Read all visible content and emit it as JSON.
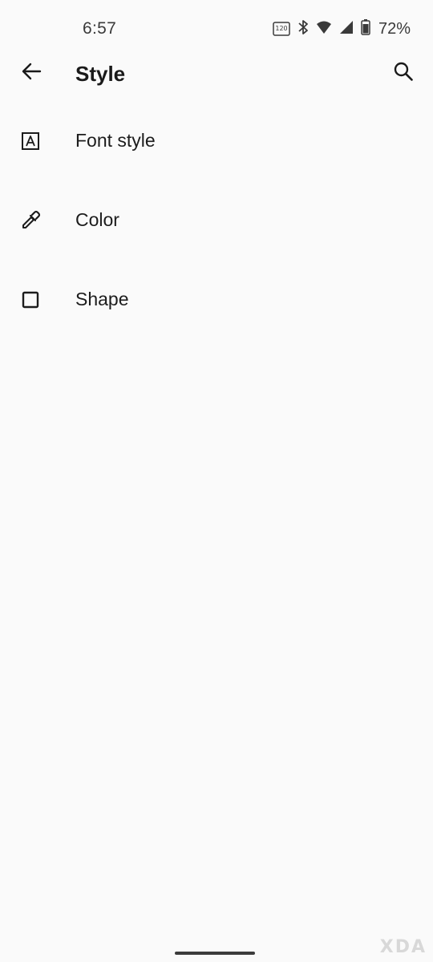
{
  "status_bar": {
    "time": "6:57",
    "refresh_rate_badge": "120",
    "battery_percent": "72%",
    "icons": [
      "refresh-rate-icon",
      "bluetooth-icon",
      "wifi-icon",
      "signal-icon",
      "battery-icon"
    ]
  },
  "app_bar": {
    "title": "Style",
    "back_icon": "arrow-back-icon",
    "search_icon": "search-icon"
  },
  "menu": {
    "items": [
      {
        "label": "Font style",
        "icon": "font-style-icon"
      },
      {
        "label": "Color",
        "icon": "eyedropper-icon"
      },
      {
        "label": "Shape",
        "icon": "square-outline-icon"
      }
    ]
  },
  "watermark": "XDA",
  "colors": {
    "background": "#fafafa",
    "text_primary": "#1c1c1c",
    "status_text": "#3a3a3a"
  }
}
